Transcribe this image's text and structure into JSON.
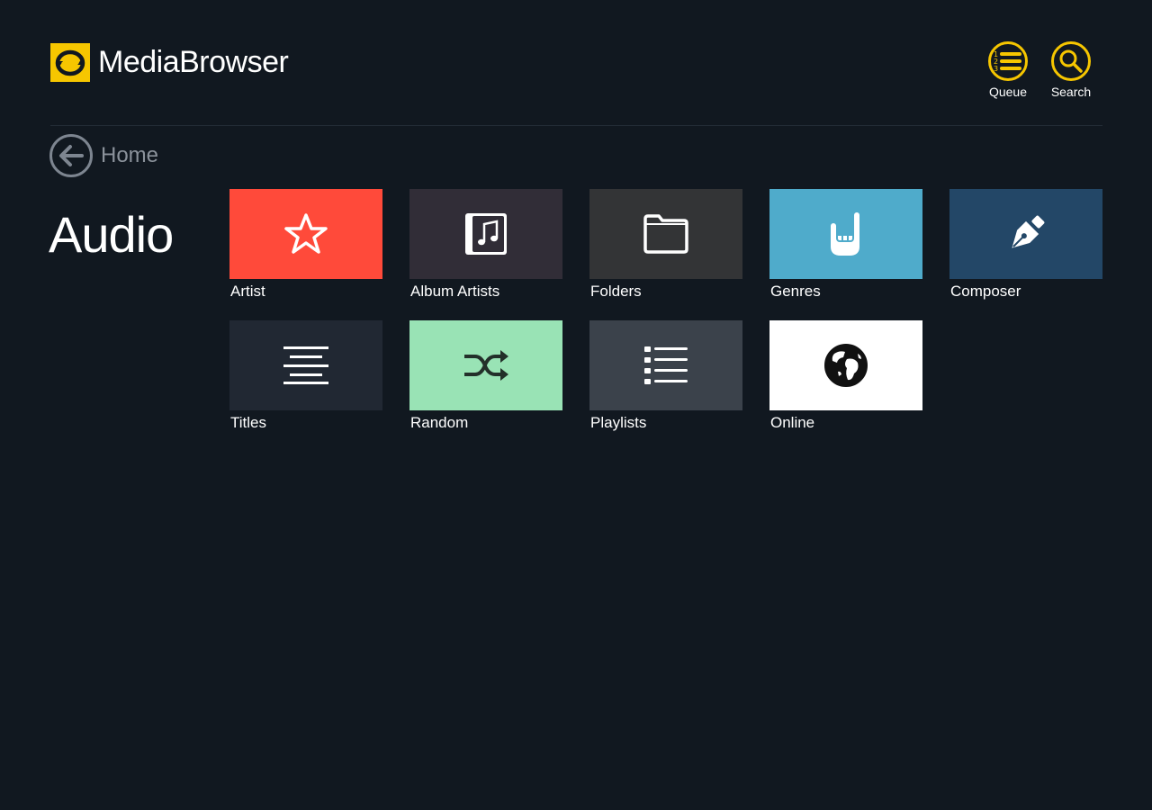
{
  "app": {
    "logo_text_light": "Media",
    "logo_text_bold": "Browser",
    "accent_color": "#f6c600"
  },
  "header": {
    "queue_label": "Queue",
    "search_label": "Search",
    "queue_icon": "numbered-list-icon",
    "search_icon": "magnifier-icon"
  },
  "nav": {
    "back_label": "Home",
    "back_icon": "back-arrow-icon"
  },
  "page": {
    "title": "Audio"
  },
  "tiles": [
    {
      "label": "Artist",
      "color": "#ff4a3a",
      "icon": "star-icon"
    },
    {
      "label": "Album Artists",
      "color": "#312d37",
      "icon": "music-album-icon"
    },
    {
      "label": "Folders",
      "color": "#333436",
      "icon": "folder-icon"
    },
    {
      "label": "Genres",
      "color": "#4fabcb",
      "icon": "rock-hand-icon"
    },
    {
      "label": "Composer",
      "color": "#234767",
      "icon": "pen-icon"
    },
    {
      "label": "Titles",
      "color": "#212833",
      "icon": "align-center-icon"
    },
    {
      "label": "Random",
      "color": "#99e3b5",
      "icon": "shuffle-icon"
    },
    {
      "label": "Playlists",
      "color": "#3b424b",
      "icon": "list-icon"
    },
    {
      "label": "Online",
      "color": "#ffffff",
      "icon": "globe-icon"
    }
  ]
}
